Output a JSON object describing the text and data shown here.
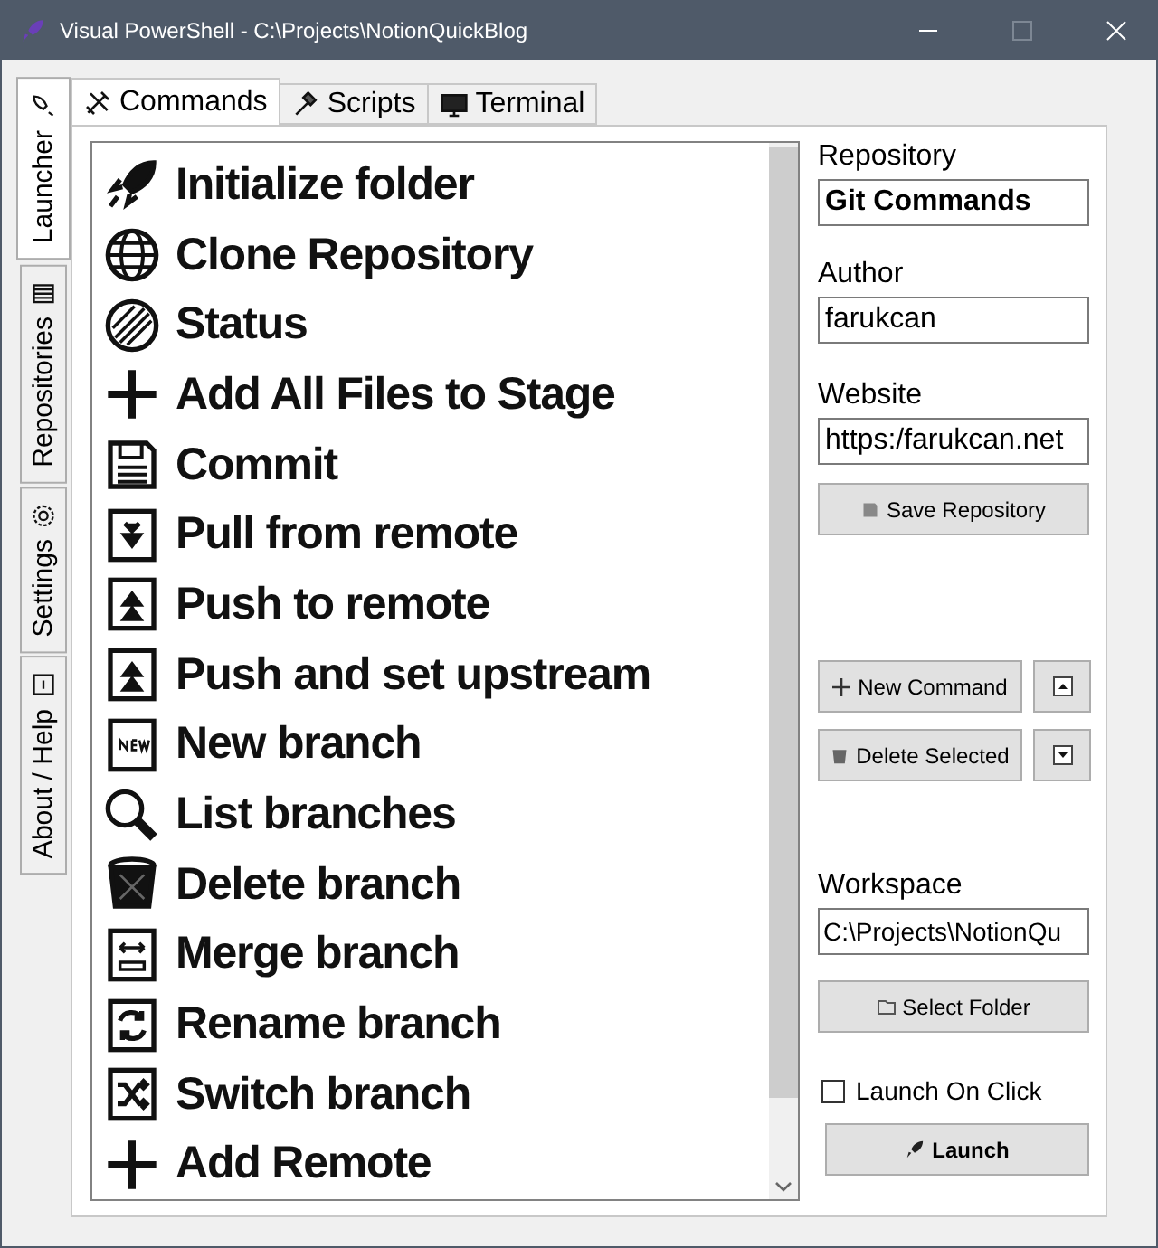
{
  "window": {
    "title": "Visual PowerShell - C:\\Projects\\NotionQuickBlog"
  },
  "side_tabs": [
    {
      "label": "Launcher",
      "kind": "rocket",
      "selected": true
    },
    {
      "label": "Repositories",
      "kind": "book",
      "selected": false
    },
    {
      "label": "Settings",
      "kind": "gear",
      "selected": false
    },
    {
      "label": "About / Help",
      "kind": "minus",
      "selected": false
    }
  ],
  "tabs": [
    {
      "label": "Commands",
      "kind": "tools",
      "selected": true
    },
    {
      "label": "Scripts",
      "kind": "hammer",
      "selected": false
    },
    {
      "label": "Terminal",
      "kind": "monitor",
      "selected": false
    }
  ],
  "commands": [
    {
      "label": "Initialize folder",
      "kind": "rocket"
    },
    {
      "label": "Clone Repository",
      "kind": "globe"
    },
    {
      "label": "Status",
      "kind": "hatched"
    },
    {
      "label": "Add All Files to Stage",
      "kind": "plus"
    },
    {
      "label": "Commit",
      "kind": "floppy"
    },
    {
      "label": "Pull from remote",
      "kind": "pull"
    },
    {
      "label": "Push to remote",
      "kind": "push"
    },
    {
      "label": "Push and set upstream",
      "kind": "push"
    },
    {
      "label": "New branch",
      "kind": "new"
    },
    {
      "label": "List branches",
      "kind": "search"
    },
    {
      "label": "Delete branch",
      "kind": "trash"
    },
    {
      "label": "Merge branch",
      "kind": "merge"
    },
    {
      "label": "Rename branch",
      "kind": "rename"
    },
    {
      "label": "Switch branch",
      "kind": "switch"
    },
    {
      "label": "Add Remote",
      "kind": "plus"
    }
  ],
  "repository": {
    "label": "Repository",
    "value": "Git Commands"
  },
  "author": {
    "label": "Author",
    "value": "farukcan"
  },
  "website": {
    "label": "Website",
    "value": "https:/farukcan.net"
  },
  "save_button": "Save Repository",
  "new_command_button": "New Command",
  "delete_button": "Delete Selected",
  "workspace": {
    "label": "Workspace",
    "value": "C:\\Projects\\NotionQu"
  },
  "select_folder_button": "Select Folder",
  "launch_on_click": {
    "label": "Launch On Click",
    "checked": false
  },
  "launch_button": "Launch"
}
